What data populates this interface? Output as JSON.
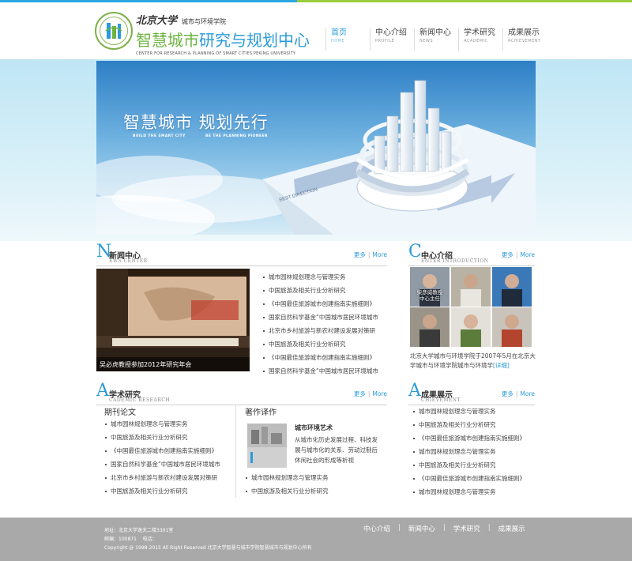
{
  "header": {
    "logo_pku": "北京大学",
    "logo_school": "城市与环境学院",
    "logo_title_a": "智慧城市",
    "logo_title_b": "研究与规划中心",
    "logo_en": "CENTER FOR RESEARCH & PLANNING OF SMART CITIES PEKING UNIVERSITY",
    "nav": [
      {
        "cn": "首页",
        "en": "HOME",
        "active": true
      },
      {
        "cn": "中心介绍",
        "en": "PROFILE"
      },
      {
        "cn": "新闻中心",
        "en": "NEWS"
      },
      {
        "cn": "学术研究",
        "en": "ACADEMIC"
      },
      {
        "cn": "成果展示",
        "en": "ACHIEVEMENT"
      }
    ]
  },
  "banner": {
    "title": "智慧城市  规划先行",
    "en_left": "BUILD THE SMART CITY",
    "en_right": "BE THE PLANNING PIONEER",
    "sign_text": "BEST DIRECTION"
  },
  "news": {
    "letter": "N",
    "title": "新闻中心",
    "en": "EWS CENTER",
    "more": "更多",
    "more_en": "More",
    "photo_caption": "吴必虎教授参加2012年研究年会",
    "items": [
      "城市园林规划理念与管理实务",
      "中国旅游及相关行业分析研究",
      "《中国最佳旅游城市创建指南实施细则》",
      "国家自然科学基金“中国城市居民环境城市",
      "北京市乡村旅游与新农村建设发展对策研",
      "中国旅游及相关行业分析研究",
      "《中国最佳旅游城市创建指南实施细则》",
      "国家自然科学基金“中国城市居民环境城市"
    ]
  },
  "center": {
    "letter": "C",
    "title": "中心介绍",
    "en": "ENTER INTRODUCTION",
    "more": "更多",
    "more_en": "More",
    "director_name": "柴彦威教授",
    "director_role": "中心主任",
    "intro": "北京大学城市与环境学院于2007年5月在北京大学城市与环境学院城市与环境学",
    "detail": "[详细]"
  },
  "academic": {
    "letter": "A",
    "title": "学术研究",
    "en": "CADEMIC RESEARCH",
    "more": "更多",
    "more_en": "More",
    "journals_title": "期刊论文",
    "journals": [
      "城市园林规划理念与管理实务",
      "中国旅游及相关行业分析研究",
      "《中国最佳旅游城市创建指南实施细则》",
      "国家自然科学基金“中国城市居民环境城市",
      "北京市乡村旅游与新农村建设发展对策研",
      "中国旅游及相关行业分析研究"
    ],
    "works_title": "著作译作",
    "book_title": "城市环境艺术",
    "book_desc": "从城市化历史发展过程、科技发展与城市化的关系、劳动过制后休闲社会的形成等析视",
    "works": [
      "城市园林规划理念与管理实务",
      "中国旅游及相关行业分析研究"
    ]
  },
  "achievement": {
    "letter": "A",
    "title": "成果展示",
    "en": "CHIEVEMENT",
    "more": "更多",
    "more_en": "More",
    "items": [
      "城市园林规划理念与管理实务",
      "中国旅游及相关行业分析研究",
      "《中国最佳旅游城市创建指南实施细则》",
      "城市园林规划理念与管理实务",
      "中国旅游及相关行业分析研究",
      "《中国最佳旅游城市创建指南实施细则》",
      "城市园林规划理念与管理实务"
    ]
  },
  "footer": {
    "address": "地址：北京大学逸夫二楼3301室",
    "postcode": "邮编：100871    电话：",
    "copyright": "Copyright @ 1998-2015 All Right Reserved 北京大学智慧与城市学院智慧城市与规划中心所有",
    "nav": [
      "中心介绍",
      "新闻中心",
      "学术研究",
      "成果展示"
    ]
  },
  "colors": {
    "accent_blue": "#2a9bd8",
    "accent_green": "#6cb33f",
    "footer_gray": "#a9a9a9"
  }
}
